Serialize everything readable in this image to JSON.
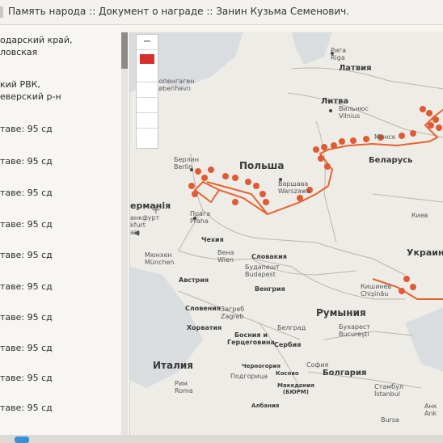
{
  "window": {
    "title": "Память народа :: Документ о награде :: Занин Кузьма Семенович."
  },
  "sidebar": {
    "lines": [
      "одарский край,",
      "ловская",
      "кий РВК,",
      "еверский р-н",
      "таве: 95 сд",
      "таве: 95 сд",
      "таве: 95 сд",
      "таве: 95 сд",
      "таве: 95 сд",
      "таве: 95 сд",
      "таве: 95 сд",
      "таве: 95 сд",
      "таве: 95 сд",
      "таве: 95 сд"
    ]
  },
  "map": {
    "zoom_in": "−",
    "zoom_out": "+",
    "pan": "◂",
    "countries": {
      "latvia": "Латвия",
      "lithuania": "Литва",
      "poland": "Польша",
      "belarus": "Беларусь",
      "czech": "Чехия",
      "slovakia": "Словакия",
      "austria": "Австрия",
      "hungary": "Венгрия",
      "romania": "Румыния",
      "croatia": "Хорватия",
      "bosnia": "Босния и\nГерцеговина",
      "serbia": "Сербия",
      "slovenia": "Словения",
      "italy": "Италия",
      "bulgaria": "Болгария",
      "montenegro": "Черногория",
      "kosovo": "Косово",
      "macedonia": "Македония\n(БЮРМ)",
      "albania": "Албания",
      "ukraine": "Украин",
      "germany": "ерманія"
    },
    "cities": {
      "riga": "Рига\nRiga",
      "copenhagen": "Копенгаген\nKøbenhavn",
      "vilnius": "Вильнюс\nVilnius",
      "minsk": "Минск",
      "berlin": "Берлин\nBerlin",
      "warsaw": "Варшава\nWarszawa",
      "kyiv": "Киев",
      "prague": "Прага\nPraha",
      "frankfurt": "анкфурт\nkfurt\nain",
      "munich": "Мюнхен\nMünchen",
      "vienna": "Вена\nWien",
      "budapest": "Будапешт\nBudapest",
      "zagreb": "Загреб\nZagreb",
      "belgrade": "Белград",
      "bucharest": "Бухарест\nBucureşti",
      "chisinau": "Кишинёв\nChişinău",
      "sofia": "София",
      "podgorica": "Подгорица",
      "rome": "Рим\nRoma",
      "istanbul": "Стамбул\nİstanbul",
      "ankara": "Анк\nAnk",
      "bursa": "Bursa"
    },
    "route_color": "#e8632f",
    "marker_color": "#e05a33"
  }
}
